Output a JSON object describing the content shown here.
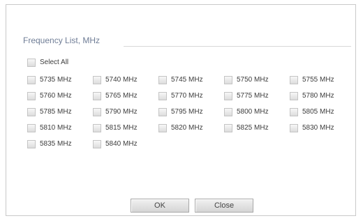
{
  "dialog": {
    "section_title": "Frequency List, MHz",
    "select_all_label": "Select All",
    "frequencies": [
      {
        "label": "5735 MHz",
        "checked": false
      },
      {
        "label": "5740 MHz",
        "checked": false
      },
      {
        "label": "5745 MHz",
        "checked": false
      },
      {
        "label": "5750 MHz",
        "checked": false
      },
      {
        "label": "5755 MHz",
        "checked": false
      },
      {
        "label": "5760 MHz",
        "checked": false
      },
      {
        "label": "5765 MHz",
        "checked": false
      },
      {
        "label": "5770 MHz",
        "checked": false
      },
      {
        "label": "5775 MHz",
        "checked": false
      },
      {
        "label": "5780 MHz",
        "checked": false
      },
      {
        "label": "5785 MHz",
        "checked": false
      },
      {
        "label": "5790 MHz",
        "checked": false
      },
      {
        "label": "5795 MHz",
        "checked": false
      },
      {
        "label": "5800 MHz",
        "checked": false
      },
      {
        "label": "5805 MHz",
        "checked": false
      },
      {
        "label": "5810 MHz",
        "checked": false
      },
      {
        "label": "5815 MHz",
        "checked": false
      },
      {
        "label": "5820 MHz",
        "checked": false
      },
      {
        "label": "5825 MHz",
        "checked": false
      },
      {
        "label": "5830 MHz",
        "checked": false
      },
      {
        "label": "5835 MHz",
        "checked": false
      },
      {
        "label": "5840 MHz",
        "checked": false
      }
    ],
    "buttons": {
      "ok_label": "OK",
      "close_label": "Close"
    }
  },
  "colors": {
    "title_text": "#6f7d96",
    "label_text": "#3c3c3c",
    "border": "#c9c9c9"
  }
}
